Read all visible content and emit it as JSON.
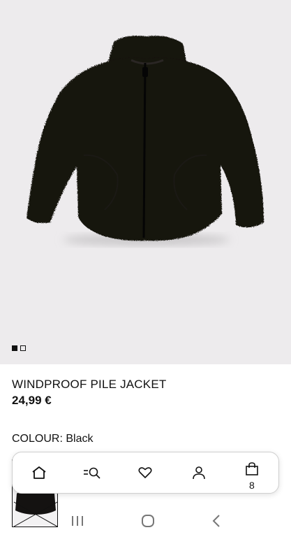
{
  "product": {
    "title": "WINDPROOF PILE JACKET",
    "price": "24,99 €",
    "colour_label": "COLOUR:",
    "colour_value": "Black"
  },
  "gallery": {
    "image_count": 2,
    "active_index": 0
  },
  "tabbar": {
    "items": [
      {
        "name": "home",
        "icon": "home-icon"
      },
      {
        "name": "search",
        "icon": "search-icon"
      },
      {
        "name": "favourites",
        "icon": "heart-icon"
      },
      {
        "name": "account",
        "icon": "user-icon"
      },
      {
        "name": "bag",
        "icon": "shopping-bag-icon",
        "badge": "8"
      }
    ]
  },
  "system_nav": [
    "recent-apps-icon",
    "home-circle-icon",
    "back-icon"
  ],
  "colors": {
    "hero_background": "#edebed",
    "jacket": "#141211",
    "text": "#111111"
  }
}
